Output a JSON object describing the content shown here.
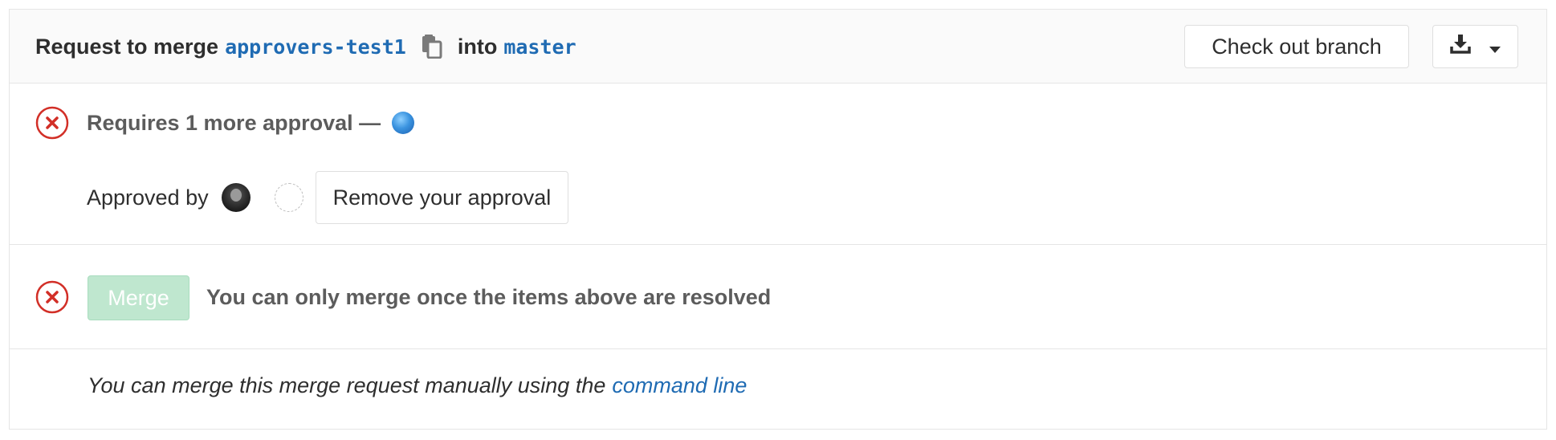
{
  "header": {
    "title_prefix": "Request to merge",
    "source_branch": "approvers-test1",
    "copy_icon": "clipboard-icon",
    "title_middle": "into",
    "target_branch": "master",
    "checkout_label": "Check out branch",
    "download_icon": "download-icon",
    "dropdown_icon": "caret-down-icon"
  },
  "approvals": {
    "status_icon": "status-failed-icon",
    "requires_text": "Requires 1 more approval —",
    "approved_by_label": "Approved by",
    "remove_label": "Remove your approval"
  },
  "merge": {
    "status_icon": "status-failed-icon",
    "merge_label": "Merge",
    "message": "You can only merge once the items above are resolved"
  },
  "footer": {
    "text": "You can merge this merge request manually using the",
    "link_text": "command line"
  },
  "colors": {
    "link": "#1f6bb3",
    "danger": "#d22f27",
    "merge_disabled": "#bfe7cf",
    "border": "#e5e5e5",
    "header_bg": "#fafafa"
  }
}
